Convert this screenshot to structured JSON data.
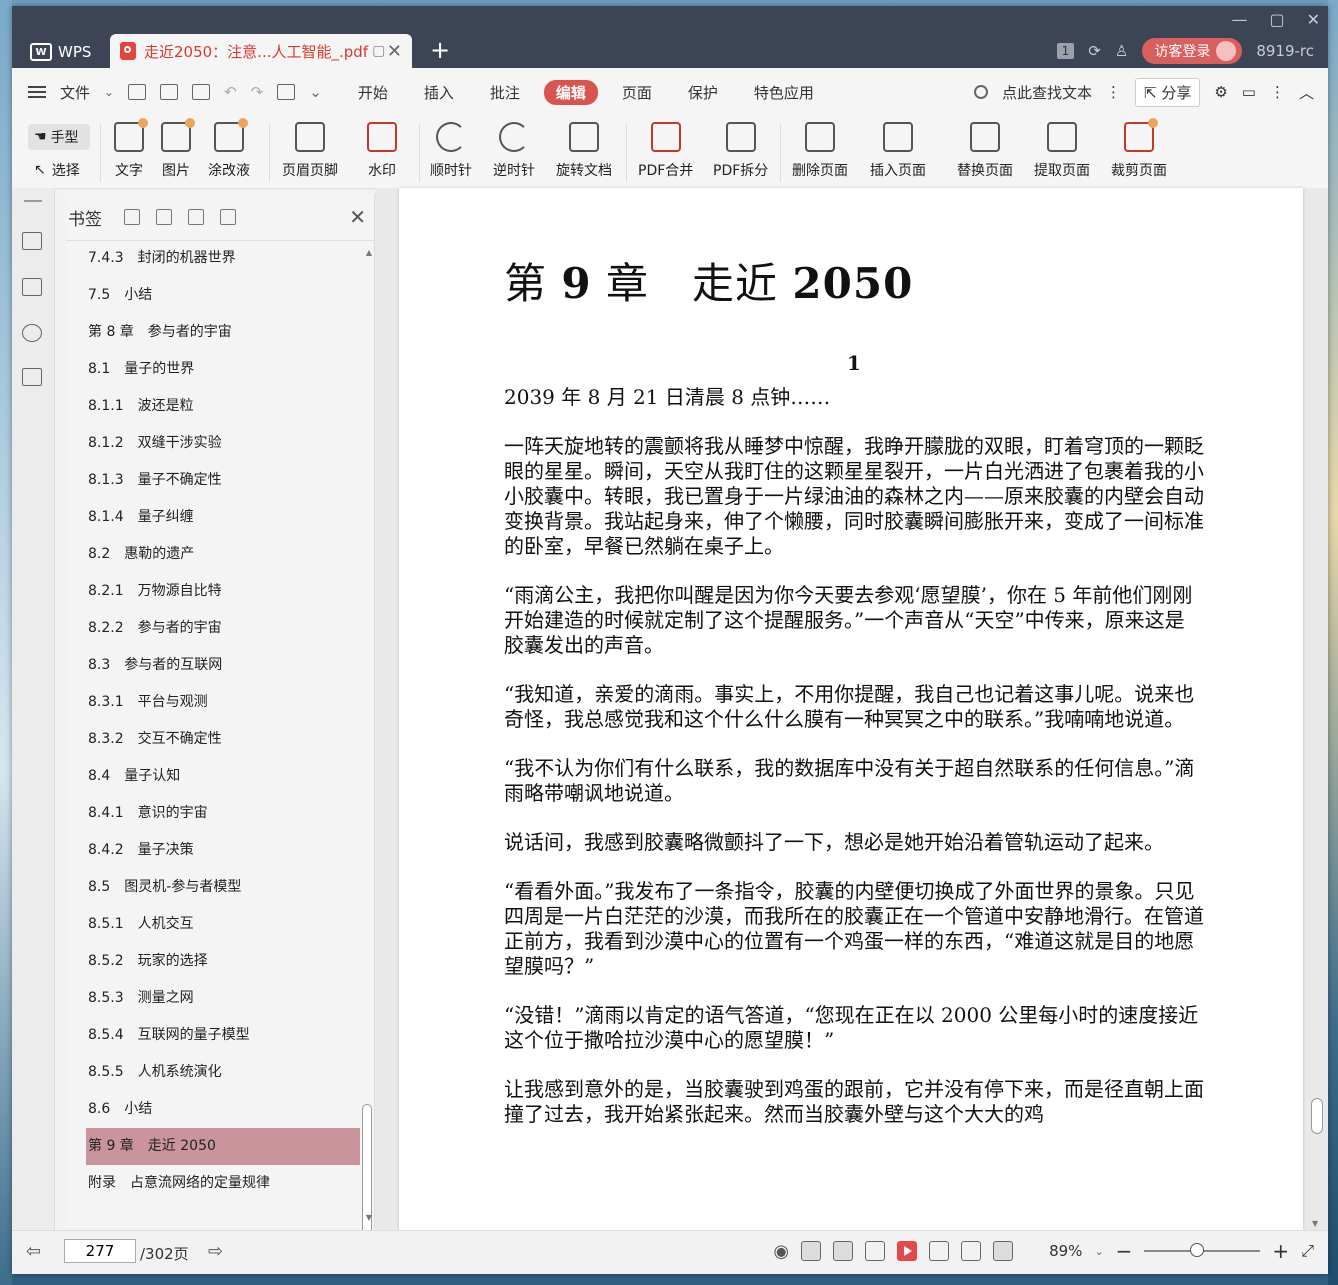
{
  "titlebar": {
    "app_name": "WPS",
    "doc_tab_title": "走近2050：注意...人工智能_.pdf",
    "new_tab_symbol": "+",
    "tab_count": "1",
    "login_label": "访客登录",
    "user_id": "8919-rc"
  },
  "menubar": {
    "file_label": "文件",
    "tabs": [
      "开始",
      "插入",
      "批注",
      "编辑",
      "页面",
      "保护",
      "特色应用"
    ],
    "active_tab": "编辑",
    "search_label": "点此查找文本",
    "share_label": "分享"
  },
  "ribbon": {
    "hand_label": "手型",
    "select_label": "选择",
    "buttons": [
      "文字",
      "图片",
      "涂改液",
      "页眉页脚",
      "水印",
      "顺时针",
      "逆时针",
      "旋转文档",
      "PDF合并",
      "PDF拆分",
      "删除页面",
      "插入页面",
      "替换页面",
      "提取页面",
      "裁剪页面"
    ]
  },
  "bookmarks": {
    "title": "书签",
    "items": [
      "7.4.3　封闭的机器世界",
      "7.5　小结",
      "第 8 章　参与者的宇宙",
      "8.1　量子的世界",
      "8.1.1　波还是粒",
      "8.1.2　双缝干涉实验",
      "8.1.3　量子不确定性",
      "8.1.4　量子纠缠",
      "8.2　惠勒的遗产",
      "8.2.1　万物源自比特",
      "8.2.2　参与者的宇宙",
      "8.3　参与者的互联网",
      "8.3.1　平台与观测",
      "8.3.2　交互不确定性",
      "8.4　量子认知",
      "8.4.1　意识的宇宙",
      "8.4.2　量子决策",
      "8.5　图灵机-参与者模型",
      "8.5.1　人机交互",
      "8.5.2　玩家的选择",
      "8.5.3　测量之网",
      "8.5.4　互联网的量子模型",
      "8.5.5　人机系统演化",
      "8.6　小结",
      "第 9 章　走近 2050",
      "附录　占意流网络的定量规律"
    ],
    "selected_index": 24
  },
  "document": {
    "chapter_prefix": "第",
    "chapter_num": "9",
    "chapter_word": "章",
    "chapter_title_cn": "走近",
    "chapter_title_num": "2050",
    "section_number": "1",
    "paragraphs": [
      "2039 年 8 月 21 日清晨 8 点钟……",
      "一阵天旋地转的震颤将我从睡梦中惊醒，我睁开朦胧的双眼，盯着穹顶的一颗眨眼的星星。瞬间，天空从我盯住的这颗星星裂开，一片白光洒进了包裹着我的小小胶囊中。转眼，我已置身于一片绿油油的森林之内——原来胶囊的内壁会自动变换背景。我站起身来，伸了个懒腰，同时胶囊瞬间膨胀开来，变成了一间标准的卧室，早餐已然躺在桌子上。",
      "“雨滴公主，我把你叫醒是因为你今天要去参观‘愿望膜’，你在 5 年前他们刚刚开始建造的时候就定制了这个提醒服务。”一个声音从“天空”中传来，原来这是胶囊发出的声音。",
      "“我知道，亲爱的滴雨。事实上，不用你提醒，我自己也记着这事儿呢。说来也奇怪，我总感觉我和这个什么什么膜有一种冥冥之中的联系。”我喃喃地说道。",
      "“我不认为你们有什么联系，我的数据库中没有关于超自然联系的任何信息。”滴雨略带嘲讽地说道。",
      "说话间，我感到胶囊略微颤抖了一下，想必是她开始沿着管轨运动了起来。",
      "“看看外面。”我发布了一条指令，胶囊的内壁便切换成了外面世界的景象。只见四周是一片白茫茫的沙漠，而我所在的胶囊正在一个管道中安静地滑行。在管道正前方，我看到沙漠中心的位置有一个鸡蛋一样的东西，“难道这就是目的地愿望膜吗？”",
      "“没错！”滴雨以肯定的语气答道，“您现在正在以 2000 公里每小时的速度接近这个位于撒哈拉沙漠中心的愿望膜！”",
      "让我感到意外的是，当胶囊驶到鸡蛋的跟前，它并没有停下来，而是径直朝上面撞了过去，我开始紧张起来。然而当胶囊外壁与这个大大的鸡"
    ]
  },
  "statusbar": {
    "current_page": "277",
    "total_pages": "/302页",
    "zoom": "89%"
  },
  "colors": {
    "titlebar_bg": "#3d4456",
    "accent_red": "#d9534f",
    "selected_bookmark": "#c9949b"
  }
}
